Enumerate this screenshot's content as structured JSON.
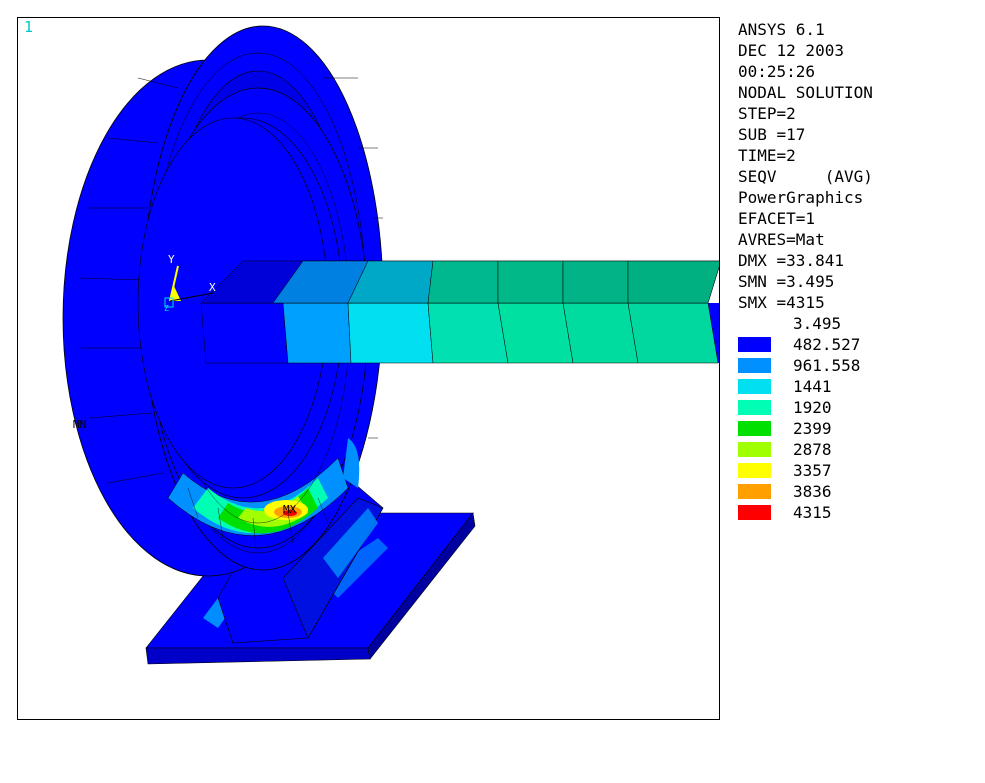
{
  "viewport": {
    "window_number": "1",
    "max_marker": "MX",
    "min_marker": "MN",
    "triad": {
      "y_label": "Y",
      "x_label": "X",
      "z_label": "Z"
    }
  },
  "info": {
    "lines": [
      "ANSYS 6.1",
      "DEC 12 2003",
      "00:25:26",
      "NODAL SOLUTION",
      "STEP=2",
      "SUB =17",
      "TIME=2",
      "SEQV     (AVG)",
      "PowerGraphics",
      "EFACET=1",
      "AVRES=Mat",
      "DMX =33.841",
      "SMN =3.495",
      "SMX =4315"
    ]
  },
  "legend": {
    "entries": [
      {
        "value": "3.495",
        "color": "#ffffff"
      },
      {
        "value": "482.527",
        "color": "#0000ff"
      },
      {
        "value": "961.558",
        "color": "#0090ff"
      },
      {
        "value": "1441",
        "color": "#00e0f0"
      },
      {
        "value": "1920",
        "color": "#00ffb4"
      },
      {
        "value": "2399",
        "color": "#00e000"
      },
      {
        "value": "2878",
        "color": "#a0ff00"
      },
      {
        "value": "3357",
        "color": "#ffff00"
      },
      {
        "value": "3836",
        "color": "#ffa000"
      },
      {
        "value": "4315",
        "color": "#ff0000"
      }
    ]
  }
}
